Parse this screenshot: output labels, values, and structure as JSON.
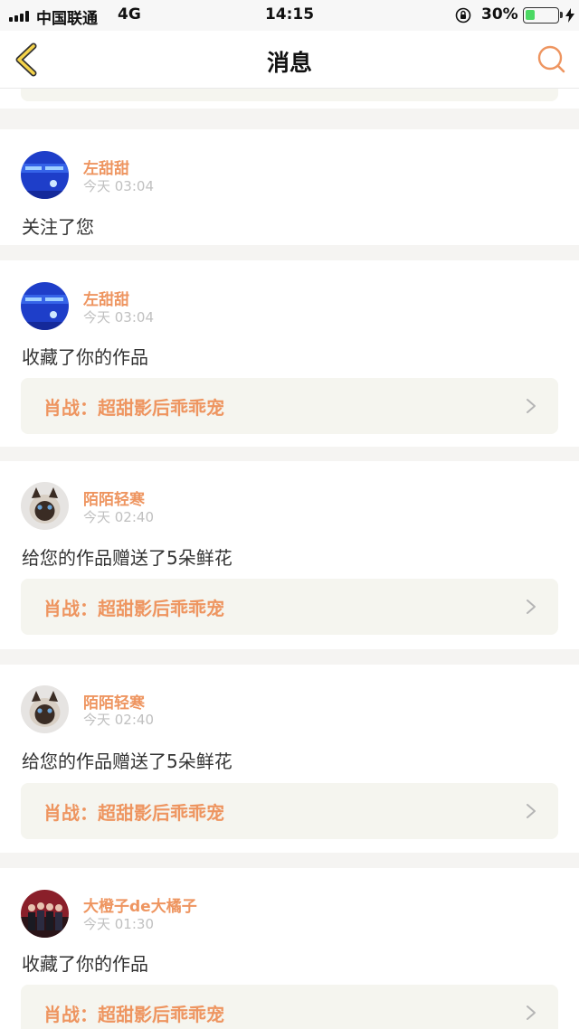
{
  "status_bar": {
    "carrier": "中国联通",
    "network": "4G",
    "time": "14:15",
    "battery_percent": "30%",
    "battery_level": 0.3,
    "battery_color": "#4cd964"
  },
  "nav": {
    "title": "消息",
    "back_icon": "chevron-left-icon",
    "search_icon": "search-icon",
    "accent_color": "#ee9560"
  },
  "messages": [
    {
      "user": "左甜甜",
      "time": "今天 03:04",
      "action": "关注了您",
      "work": "",
      "avatar": "blue-abstract"
    },
    {
      "user": "左甜甜",
      "time": "今天 03:04",
      "action": "收藏了你的作品",
      "work": "肖战：超甜影后乖乖宠",
      "avatar": "blue-abstract"
    },
    {
      "user": "陌陌轻寒",
      "time": "今天 02:40",
      "action": "给您的作品赠送了5朵鲜花",
      "work": "肖战：超甜影后乖乖宠",
      "avatar": "siamese-cat"
    },
    {
      "user": "陌陌轻寒",
      "time": "今天 02:40",
      "action": "给您的作品赠送了5朵鲜花",
      "work": "肖战：超甜影后乖乖宠",
      "avatar": "siamese-cat"
    },
    {
      "user": "大橙子de大橘子",
      "time": "今天 01:30",
      "action": "收藏了你的作品",
      "work": "肖战：超甜影后乖乖宠",
      "avatar": "group-photo"
    }
  ]
}
